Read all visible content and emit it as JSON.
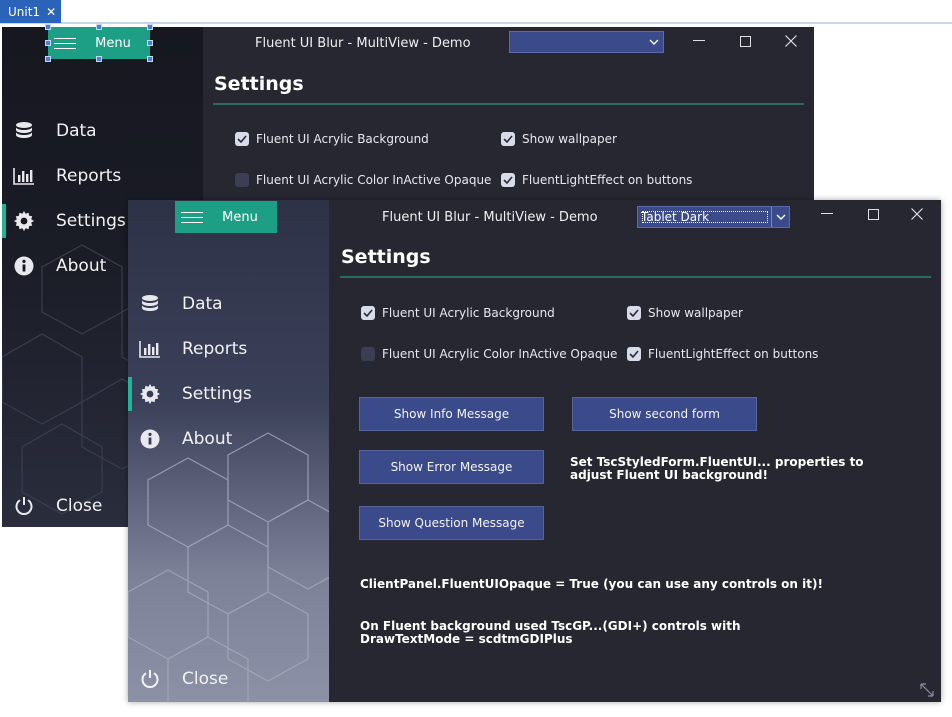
{
  "ide": {
    "tab_label": "Unit1",
    "tab_close": "✕"
  },
  "back_window": {
    "menu_label": "Menu",
    "title": "Fluent UI Blur - MultiView - Demo",
    "style_combo_value": "",
    "heading": "Settings",
    "nav": [
      {
        "label": "Data",
        "icon": "database-icon"
      },
      {
        "label": "Reports",
        "icon": "bar-chart-icon"
      },
      {
        "label": "Settings",
        "icon": "gear-icon"
      },
      {
        "label": "About",
        "icon": "info-icon"
      }
    ],
    "close_label": "Close",
    "checkboxes": [
      {
        "label": "Fluent UI Acrylic Background",
        "checked": true
      },
      {
        "label": "Show wallpaper",
        "checked": true
      },
      {
        "label": "Fluent UI Acrylic Color InActive Opaque",
        "checked": false
      },
      {
        "label": "FluentLightEffect on buttons",
        "checked": true
      }
    ]
  },
  "front_window": {
    "menu_label": "Menu",
    "title": "Fluent UI Blur - MultiView - Demo",
    "style_combo_value": "Tablet Dark",
    "heading": "Settings",
    "nav": [
      {
        "label": "Data",
        "icon": "database-icon"
      },
      {
        "label": "Reports",
        "icon": "bar-chart-icon"
      },
      {
        "label": "Settings",
        "icon": "gear-icon"
      },
      {
        "label": "About",
        "icon": "info-icon"
      }
    ],
    "close_label": "Close",
    "checkboxes": [
      {
        "label": "Fluent UI Acrylic Background",
        "checked": true
      },
      {
        "label": "Show wallpaper",
        "checked": true
      },
      {
        "label": "Fluent UI Acrylic Color InActive Opaque",
        "checked": false
      },
      {
        "label": "FluentLightEffect on buttons",
        "checked": true
      }
    ],
    "buttons": {
      "info": "Show Info Message",
      "second_form": "Show second form",
      "error": "Show Error Message",
      "question": "Show Question Message"
    },
    "notes": {
      "styled_form_line1": "Set TscStyledForm.FluentUI... properties to",
      "styled_form_line2": "adjust Fluent UI background!",
      "client_panel": "ClientPanel.FluentUIOpaque = True (you can use any controls on it)!",
      "gdi_line1": "On Fluent background used TscGP...(GDI+) controls with",
      "gdi_line2": "DrawTextMode = scdtmGDIPlus"
    }
  },
  "colors": {
    "window_bg": "#272731",
    "accent": "#1d9f85",
    "button_bg": "#3b4a8a",
    "ide_tab": "#2a63b8"
  }
}
